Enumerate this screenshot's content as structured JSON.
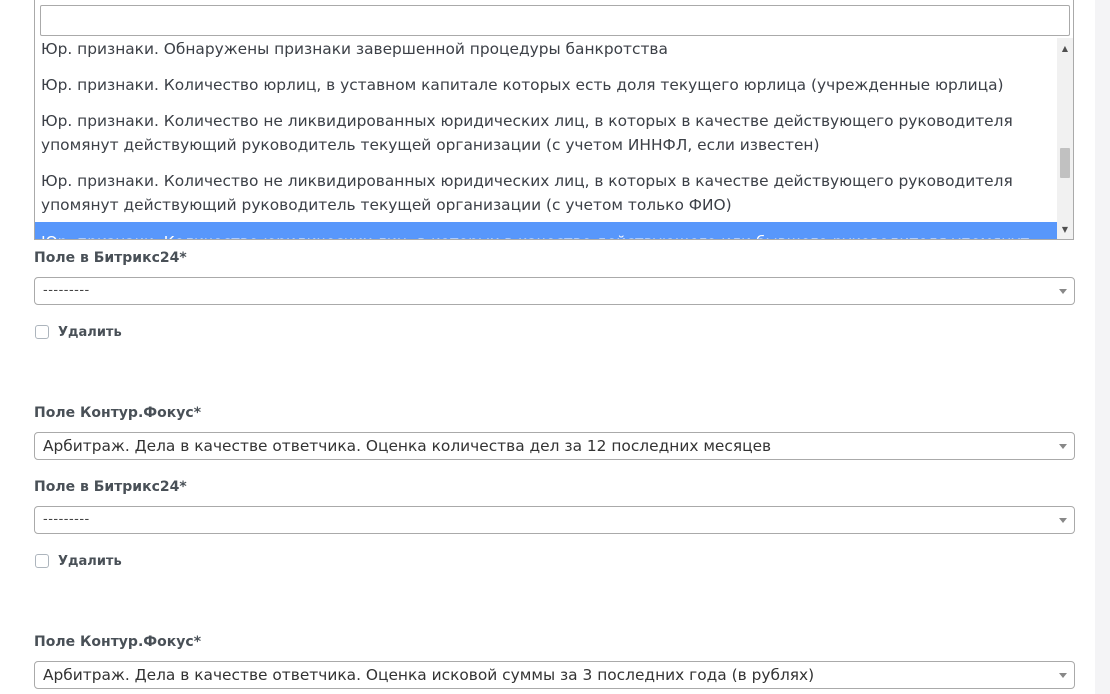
{
  "dropdown": {
    "search_value": "",
    "options": [
      "Юр. признаки. Обнаружены признаки завершенной процедуры банкротства",
      "Юр. признаки. Количество юрлиц, в уставном капитале которых есть доля текущего юрлица (учрежденные юрлица)",
      "Юр. признаки. Количество не ликвидированных юридических лиц, в которых в качестве действующего руководителя упомянут действующий руководитель текущей организации (с учетом ИННФЛ, если известен)",
      "Юр. признаки. Количество не ликвидированных юридических лиц, в которых в качестве действующего руководителя упомянут действующий руководитель текущей организации (с учетом только ФИО)",
      "Юр. признаки. Количество юридических лиц, в которых в качестве действующего или бывшего руководителя упомянут"
    ],
    "highlighted_index": 4
  },
  "mappings": [
    {
      "bitrix_label": "Поле в Битрикс24*",
      "bitrix_value": "---------",
      "delete_label": "Удалить",
      "delete_checked": false
    },
    {
      "kontur_label": "Поле Контур.Фокус*",
      "kontur_value": "Арбитраж. Дела в качестве ответчика. Оценка количества дел за 12 последних месяцев",
      "bitrix_label": "Поле в Битрикс24*",
      "bitrix_value": "---------",
      "delete_label": "Удалить",
      "delete_checked": false
    },
    {
      "kontur_label": "Поле Контур.Фокус*",
      "kontur_value": "Арбитраж. Дела в качестве ответчика. Оценка исковой суммы за 3 последних года (в рублях)"
    }
  ],
  "icons": {
    "dropdown_arrow": "chevron-down-icon",
    "scroll_up": "scroll-up-arrow-icon",
    "scroll_down": "scroll-down-arrow-icon"
  },
  "colors": {
    "highlight": "#5897fb",
    "page_background": "#f4f4f6"
  }
}
